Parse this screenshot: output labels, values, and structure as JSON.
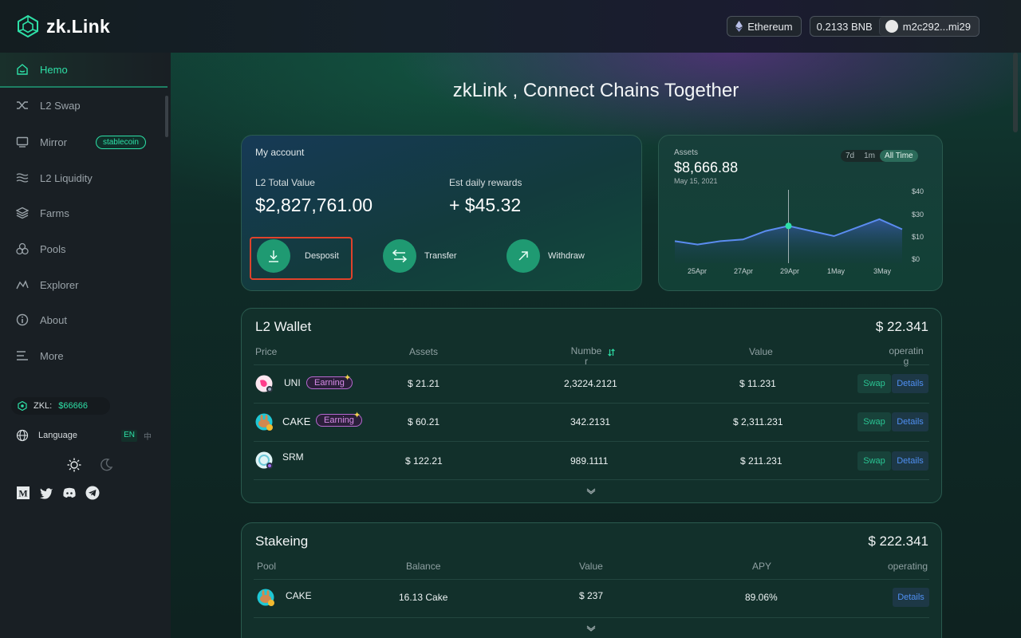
{
  "header": {
    "logo_text": "zk.Link",
    "network": "Ethereum",
    "balance": "0.2133 BNB",
    "address": "m2c292...mi29"
  },
  "sidebar": {
    "items": [
      {
        "label": "Hemo",
        "icon": "home-icon"
      },
      {
        "label": "L2 Swap",
        "icon": "shuffle-icon"
      },
      {
        "label": "Mirror",
        "icon": "monitor-icon",
        "badge": "stablecoin"
      },
      {
        "label": "L2 Liquidity",
        "icon": "waves-icon"
      },
      {
        "label": "Farms",
        "icon": "layers-icon"
      },
      {
        "label": "Pools",
        "icon": "circles-icon"
      },
      {
        "label": "Explorer",
        "icon": "chart-line-icon"
      },
      {
        "label": "About",
        "icon": "info-icon"
      },
      {
        "label": "More",
        "icon": "menu-icon"
      }
    ],
    "zkl_label": "ZKL:",
    "zkl_value": "$66666",
    "language_label": "Language",
    "lang_en": "EN",
    "lang_zh": "中"
  },
  "main": {
    "hero_title": "zkLink , Connect Chains Together"
  },
  "account": {
    "title": "My account",
    "total_label": "L2 Total Value",
    "total_value": "$2,827,761.00",
    "rewards_label": "Est daily rewards",
    "rewards_value": "+ $45.32",
    "deposit_label": "Desposit",
    "transfer_label": "Transfer",
    "withdraw_label": "Withdraw"
  },
  "assets": {
    "label": "Assets",
    "value": "$8,666.88",
    "date": "May 15, 2021",
    "ranges": [
      "7d",
      "1m",
      "All Time"
    ],
    "active_range": "All Time"
  },
  "chart_data": {
    "type": "area",
    "categories": [
      "25Apr",
      "27Apr",
      "29Apr",
      "1May",
      "3May"
    ],
    "x_ticks": [
      "25Apr",
      "27Apr",
      "29Apr",
      "1May",
      "3May"
    ],
    "y_ticks": [
      "$40",
      "$30",
      "$10",
      "$0"
    ],
    "ylim": [
      0,
      40
    ],
    "series": [
      {
        "values": [
          13,
          11,
          13,
          14,
          19,
          22,
          19,
          16,
          21,
          26,
          20
        ]
      }
    ],
    "highlight_category": "29Apr",
    "color": "#5b8cf0"
  },
  "wallet": {
    "title": "L2 Wallet",
    "total": "$ 22.341",
    "columns": [
      "Price",
      "Assets",
      "Numbe r",
      "Value",
      "operatin g"
    ],
    "rows": [
      {
        "symbol": "UNI",
        "tag": "Earning",
        "price": "$ 21.21",
        "number": "2,3224.2121",
        "value": "$ 11.231"
      },
      {
        "symbol": "CAKE",
        "tag": "Earning",
        "price": "$ 60.21",
        "number": "342.2131",
        "value": "$ 2,311.231"
      },
      {
        "symbol": "SRM",
        "tag": "",
        "price": "$ 122.21",
        "number": "989.1111",
        "value": "$ 211.231"
      }
    ],
    "swap_label": "Swap",
    "details_label": "Details"
  },
  "staking": {
    "title": "Stakeing",
    "total": "$ 222.341",
    "columns": [
      "Pool",
      "Balance",
      "Value",
      "APY",
      "operating"
    ],
    "rows": [
      {
        "symbol": "CAKE",
        "balance": "16.13 Cake",
        "value": "$ 237",
        "apy": "89.06%"
      }
    ],
    "details_label": "Details"
  }
}
